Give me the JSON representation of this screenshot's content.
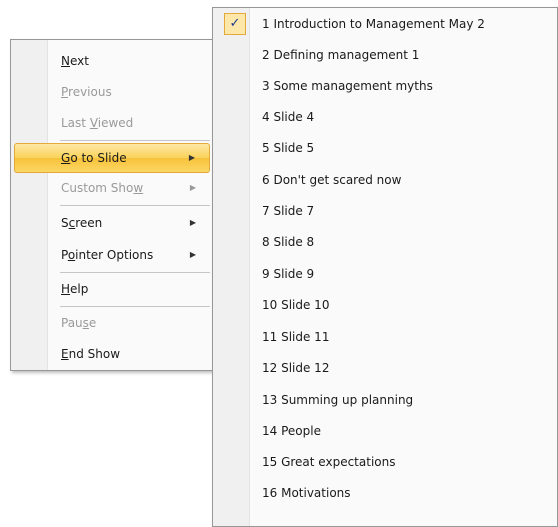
{
  "main_menu": {
    "items": [
      {
        "pre": "",
        "ul": "N",
        "post": "ext",
        "disabled": false,
        "submenu": false
      },
      {
        "pre": "",
        "ul": "P",
        "post": "revious",
        "disabled": true,
        "submenu": false
      },
      {
        "pre": "Last ",
        "ul": "V",
        "post": "iewed",
        "disabled": true,
        "submenu": false
      },
      {
        "pre": "",
        "ul": "G",
        "post": "o to Slide",
        "disabled": false,
        "submenu": true,
        "highlighted": true
      },
      {
        "pre": "Custom Sho",
        "ul": "w",
        "post": "",
        "disabled": true,
        "submenu": true
      },
      {
        "pre": "S",
        "ul": "c",
        "post": "reen",
        "disabled": false,
        "submenu": true
      },
      {
        "pre": "P",
        "ul": "o",
        "post": "inter Options",
        "disabled": false,
        "submenu": true
      },
      {
        "pre": "",
        "ul": "H",
        "post": "elp",
        "disabled": false,
        "submenu": false
      },
      {
        "pre": "Pau",
        "ul": "s",
        "post": "e",
        "disabled": true,
        "submenu": false
      },
      {
        "pre": "",
        "ul": "E",
        "post": "nd Show",
        "disabled": false,
        "submenu": false
      }
    ],
    "arrow_glyph": "▶"
  },
  "slide_menu": {
    "check_glyph": "✓",
    "items": [
      "1 Introduction to Management May 2",
      "2 Defining management 1",
      "3 Some management myths",
      "4 Slide 4",
      "5 Slide 5",
      "6 Don't get scared now",
      "7 Slide 7",
      "8 Slide 8",
      "9 Slide 9",
      "10 Slide 10",
      "11 Slide 11",
      "12 Slide 12",
      "13 Summing up planning",
      "14 People",
      "15 Great expectations",
      "16 Motivations"
    ],
    "checked_index": 0
  },
  "colors": {
    "highlight": "#fbd35a",
    "highlight_border": "#e3a93a",
    "disabled_text": "#9a9a9a"
  }
}
